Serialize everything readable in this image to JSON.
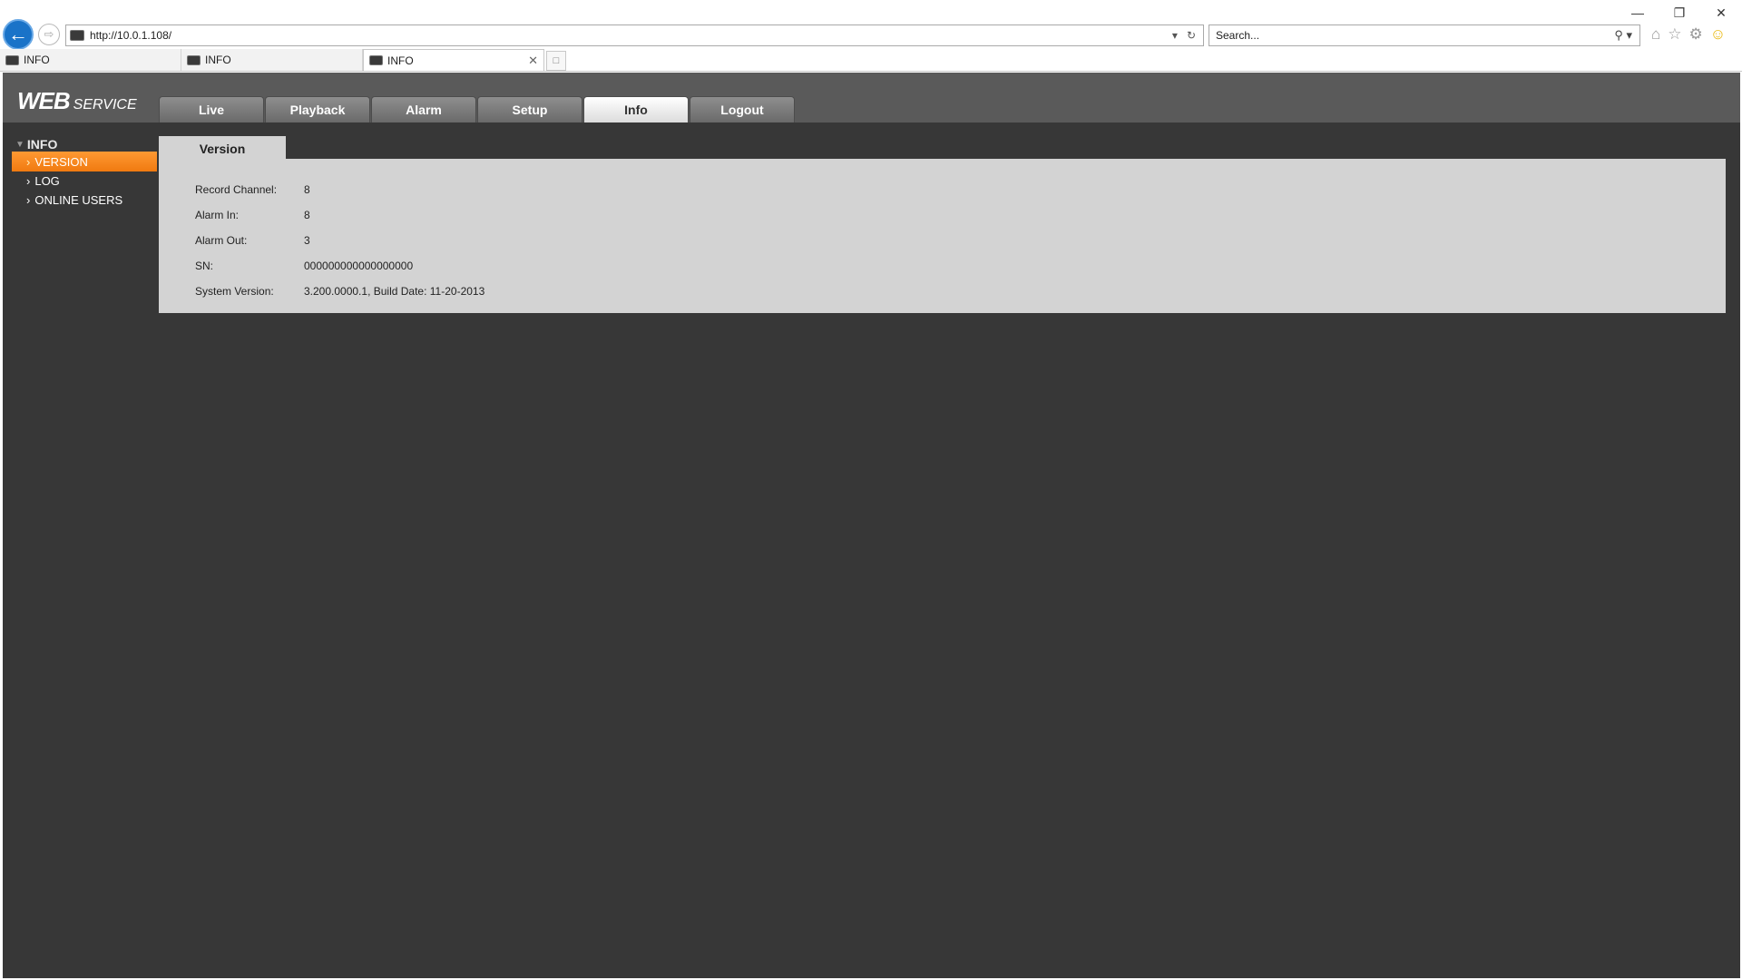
{
  "browser": {
    "url": "http://10.0.1.108/",
    "search_placeholder": "Search...",
    "tabs": [
      {
        "title": "INFO"
      },
      {
        "title": "INFO"
      },
      {
        "title": "INFO"
      }
    ]
  },
  "app": {
    "logo_main": "WEB",
    "logo_sub": "SERVICE",
    "main_tabs": [
      {
        "label": "Live"
      },
      {
        "label": "Playback"
      },
      {
        "label": "Alarm"
      },
      {
        "label": "Setup"
      },
      {
        "label": "Info"
      },
      {
        "label": "Logout"
      }
    ],
    "active_tab": "Info"
  },
  "sidebar": {
    "header": "INFO",
    "items": [
      {
        "label": "VERSION"
      },
      {
        "label": "LOG"
      },
      {
        "label": "ONLINE USERS"
      }
    ],
    "active_item": "VERSION"
  },
  "content": {
    "tab_title": "Version",
    "rows": [
      {
        "label": "Record Channel:",
        "value": "8"
      },
      {
        "label": "Alarm In:",
        "value": "8"
      },
      {
        "label": "Alarm Out:",
        "value": "3"
      },
      {
        "label": "SN:",
        "value": "000000000000000000"
      },
      {
        "label": "System Version:",
        "value": "3.200.0000.1, Build Date: 11-20-2013"
      }
    ]
  },
  "colors": {
    "page_bg": "#373737",
    "topbar_bg": "#5a5a5a",
    "accent_orange": "#f5871f",
    "panel_bg": "#d3d3d3"
  }
}
